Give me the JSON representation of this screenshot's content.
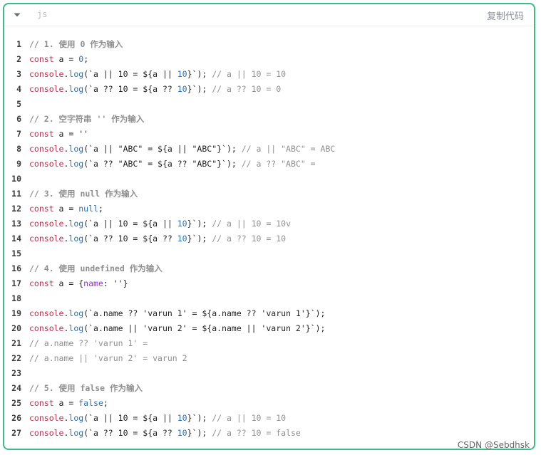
{
  "header": {
    "language": "js",
    "copy_label": "复制代码"
  },
  "watermark": "CSDN @Sebdhsk",
  "lines": [
    {
      "n": "1",
      "tokens": [
        {
          "t": "// 1. 使用 0 作为输入",
          "c": "cb"
        }
      ]
    },
    {
      "n": "2",
      "tokens": [
        {
          "t": "const",
          "c": "k"
        },
        {
          "t": " a = ",
          "c": "p"
        },
        {
          "t": "0",
          "c": "n"
        },
        {
          "t": ";",
          "c": "p"
        }
      ]
    },
    {
      "n": "3",
      "tokens": [
        {
          "t": "console",
          "c": "k"
        },
        {
          "t": ".",
          "c": "p"
        },
        {
          "t": "log",
          "c": "f"
        },
        {
          "t": "(`a || 10 = ${a || ",
          "c": "s"
        },
        {
          "t": "10",
          "c": "n"
        },
        {
          "t": "}`); ",
          "c": "s"
        },
        {
          "t": "// a || 10 = 10",
          "c": "c"
        }
      ]
    },
    {
      "n": "4",
      "tokens": [
        {
          "t": "console",
          "c": "k"
        },
        {
          "t": ".",
          "c": "p"
        },
        {
          "t": "log",
          "c": "f"
        },
        {
          "t": "(`a ?? 10 = ${a ?? ",
          "c": "s"
        },
        {
          "t": "10",
          "c": "n"
        },
        {
          "t": "}`); ",
          "c": "s"
        },
        {
          "t": "// a ?? 10 = 0",
          "c": "c"
        }
      ]
    },
    {
      "n": "5",
      "tokens": []
    },
    {
      "n": "6",
      "tokens": [
        {
          "t": "// 2. 空字符串 '' 作为输入",
          "c": "cb"
        }
      ]
    },
    {
      "n": "7",
      "tokens": [
        {
          "t": "const",
          "c": "k"
        },
        {
          "t": " a = ''",
          "c": "p"
        }
      ]
    },
    {
      "n": "8",
      "tokens": [
        {
          "t": "console",
          "c": "k"
        },
        {
          "t": ".",
          "c": "p"
        },
        {
          "t": "log",
          "c": "f"
        },
        {
          "t": "(`a || \"ABC\" = ${a || \"ABC\"}`); ",
          "c": "s"
        },
        {
          "t": "// a || \"ABC\" = ABC",
          "c": "c"
        }
      ]
    },
    {
      "n": "9",
      "tokens": [
        {
          "t": "console",
          "c": "k"
        },
        {
          "t": ".",
          "c": "p"
        },
        {
          "t": "log",
          "c": "f"
        },
        {
          "t": "(`a ?? \"ABC\" = ${a ?? \"ABC\"}`); ",
          "c": "s"
        },
        {
          "t": "// a ?? \"ABC\" = ",
          "c": "c"
        }
      ]
    },
    {
      "n": "10",
      "tokens": []
    },
    {
      "n": "11",
      "tokens": [
        {
          "t": "// 3. 使用 null 作为输入",
          "c": "cb"
        }
      ]
    },
    {
      "n": "12",
      "tokens": [
        {
          "t": "const",
          "c": "k"
        },
        {
          "t": " a = ",
          "c": "p"
        },
        {
          "t": "null",
          "c": "n"
        },
        {
          "t": ";",
          "c": "p"
        }
      ]
    },
    {
      "n": "13",
      "tokens": [
        {
          "t": "console",
          "c": "k"
        },
        {
          "t": ".",
          "c": "p"
        },
        {
          "t": "log",
          "c": "f"
        },
        {
          "t": "(`a || 10 = ${a || ",
          "c": "s"
        },
        {
          "t": "10",
          "c": "n"
        },
        {
          "t": "}`); ",
          "c": "s"
        },
        {
          "t": "// a || 10 = 10v",
          "c": "c"
        }
      ]
    },
    {
      "n": "14",
      "tokens": [
        {
          "t": "console",
          "c": "k"
        },
        {
          "t": ".",
          "c": "p"
        },
        {
          "t": "log",
          "c": "f"
        },
        {
          "t": "(`a ?? 10 = ${a ?? ",
          "c": "s"
        },
        {
          "t": "10",
          "c": "n"
        },
        {
          "t": "}`); ",
          "c": "s"
        },
        {
          "t": "// a ?? 10 = 10",
          "c": "c"
        }
      ]
    },
    {
      "n": "15",
      "tokens": []
    },
    {
      "n": "16",
      "tokens": [
        {
          "t": "// 4. 使用 undefined 作为输入",
          "c": "cb"
        }
      ]
    },
    {
      "n": "17",
      "tokens": [
        {
          "t": "const",
          "c": "k"
        },
        {
          "t": " a = {",
          "c": "p"
        },
        {
          "t": "name",
          "c": "prop"
        },
        {
          "t": ": ''}",
          "c": "p"
        }
      ]
    },
    {
      "n": "18",
      "tokens": []
    },
    {
      "n": "19",
      "tokens": [
        {
          "t": "console",
          "c": "k"
        },
        {
          "t": ".",
          "c": "p"
        },
        {
          "t": "log",
          "c": "f"
        },
        {
          "t": "(`a.name ?? 'varun 1' = ${a.name ?? 'varun 1'}`);",
          "c": "s"
        }
      ]
    },
    {
      "n": "20",
      "tokens": [
        {
          "t": "console",
          "c": "k"
        },
        {
          "t": ".",
          "c": "p"
        },
        {
          "t": "log",
          "c": "f"
        },
        {
          "t": "(`a.name || 'varun 2' = ${a.name || 'varun 2'}`);",
          "c": "s"
        }
      ]
    },
    {
      "n": "21",
      "tokens": [
        {
          "t": "// a.name ?? 'varun 1' = ",
          "c": "c"
        }
      ]
    },
    {
      "n": "22",
      "tokens": [
        {
          "t": "// a.name || 'varun 2' = varun 2",
          "c": "c"
        }
      ]
    },
    {
      "n": "23",
      "tokens": []
    },
    {
      "n": "24",
      "tokens": [
        {
          "t": "// 5. 使用 false 作为输入",
          "c": "cb"
        }
      ]
    },
    {
      "n": "25",
      "tokens": [
        {
          "t": "const",
          "c": "k"
        },
        {
          "t": " a = ",
          "c": "p"
        },
        {
          "t": "false",
          "c": "n"
        },
        {
          "t": ";",
          "c": "p"
        }
      ]
    },
    {
      "n": "26",
      "tokens": [
        {
          "t": "console",
          "c": "k"
        },
        {
          "t": ".",
          "c": "p"
        },
        {
          "t": "log",
          "c": "f"
        },
        {
          "t": "(`a || 10 = ${a || ",
          "c": "s"
        },
        {
          "t": "10",
          "c": "n"
        },
        {
          "t": "}`); ",
          "c": "s"
        },
        {
          "t": "// a || 10 = 10",
          "c": "c"
        }
      ]
    },
    {
      "n": "27",
      "tokens": [
        {
          "t": "console",
          "c": "k"
        },
        {
          "t": ".",
          "c": "p"
        },
        {
          "t": "log",
          "c": "f"
        },
        {
          "t": "(`a ?? 10 = ${a ?? ",
          "c": "s"
        },
        {
          "t": "10",
          "c": "n"
        },
        {
          "t": "}`); ",
          "c": "s"
        },
        {
          "t": "// a ?? 10 = false",
          "c": "c"
        }
      ]
    }
  ]
}
